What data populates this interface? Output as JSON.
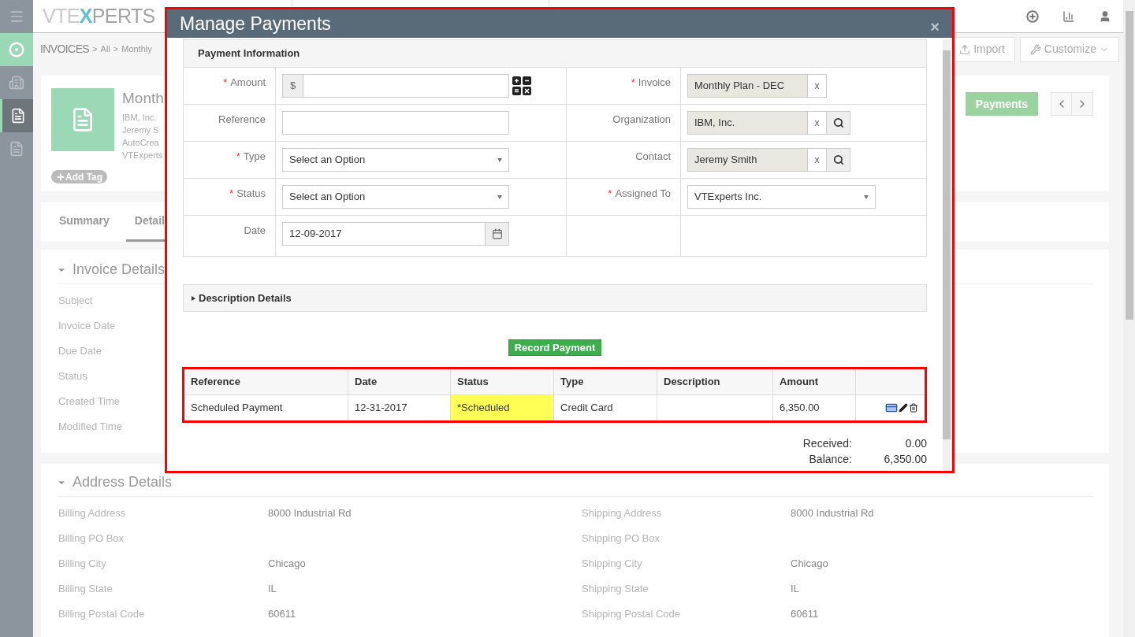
{
  "sidebar": {
    "items": [
      {
        "kind": "menu",
        "selected": false
      },
      {
        "kind": "home",
        "selected": false
      },
      {
        "kind": "organizations",
        "selected": false
      },
      {
        "kind": "invoices",
        "selected": true
      },
      {
        "kind": "sales-orders",
        "selected": false
      }
    ]
  },
  "logo": {
    "parts": [
      {
        "text": "VTE",
        "color": "#c9c9c9"
      },
      {
        "text": "X",
        "color": "#5cc3cb"
      },
      {
        "text": "PERTS",
        "color": "#a3a3a3"
      }
    ]
  },
  "breadcrumb": {
    "module": "INVOICES",
    "items": [
      {
        "separator": ">",
        "label": "All"
      },
      {
        "separator": ">",
        "label": "Monthly"
      }
    ]
  },
  "header_buttons": [
    {
      "label": "Import",
      "kind": "import"
    },
    {
      "label": "Customize",
      "kind": "customize"
    }
  ],
  "record": {
    "title": "Month",
    "lines": [
      "IBM, Inc.",
      "Jeremy S",
      "AutoCrea",
      "VTExperts"
    ],
    "add_tag": "Add Tag",
    "action": "Payments"
  },
  "tabs": [
    {
      "label": "Summary",
      "selected": false
    },
    {
      "label": "Detail",
      "selected": true
    }
  ],
  "invoice_details": {
    "title": "Invoice Details",
    "labels": [
      "Subject",
      "Invoice Date",
      "Due Date",
      "Status",
      "Created Time",
      "Modified Time"
    ]
  },
  "address_details": {
    "title": "Address Details",
    "fields": [
      {
        "label": "Billing Address",
        "value": "8000 Industrial Rd"
      },
      {
        "label": "Shipping Address",
        "value": "8000 Industrial Rd"
      },
      {
        "label": "Billing PO Box"
      },
      {
        "label": "Shipping PO Box"
      },
      {
        "label": "Billing City",
        "value": "Chicago"
      },
      {
        "label": "Shipping City",
        "value": "Chicago"
      },
      {
        "label": "Billing State",
        "value": "IL"
      },
      {
        "label": "Shipping State",
        "value": "IL"
      },
      {
        "label": "Billing Postal Code",
        "value": "60611"
      },
      {
        "label": "Shipping Postal Code",
        "value": "60611"
      }
    ]
  },
  "modal": {
    "title": "Manage Payments",
    "close": "×",
    "payment_information": {
      "title": "Payment Information",
      "fields": [
        {
          "label": "Amount",
          "required_mark": "*",
          "kind": "currency",
          "prefix": "$"
        },
        {
          "label": "Invoice",
          "required_mark": "*",
          "kind": "reference",
          "value": "Monthly Plan - DEC",
          "clear": "x",
          "search": false
        },
        {
          "label": "Reference",
          "kind": "text"
        },
        {
          "label": "Organization",
          "kind": "reference",
          "value": "IBM, Inc.",
          "clear": "x",
          "search": true
        },
        {
          "label": "Type",
          "required_mark": "*",
          "kind": "select",
          "value": "Select an Option"
        },
        {
          "label": "Contact",
          "kind": "reference",
          "value": "Jeremy Smith",
          "clear": "x",
          "search": true
        },
        {
          "label": "Status",
          "required_mark": "*",
          "kind": "select",
          "value": "Select an Option"
        },
        {
          "label": "Assigned To",
          "required_mark": "*",
          "kind": "picklist",
          "value": "VTExperts Inc."
        },
        {
          "label": "Date",
          "kind": "date",
          "value": "12-09-2017"
        }
      ]
    },
    "description": {
      "title": "Description Details",
      "expanded": false
    },
    "record_button": "Record Payment",
    "table": {
      "columns": [
        "Reference",
        "Date",
        "Status",
        "Type",
        "Description",
        "Amount"
      ],
      "rows": [
        {
          "cells": [
            {
              "text": "Scheduled Payment",
              "highlight": false
            },
            {
              "text": "12-31-2017",
              "highlight": false
            },
            {
              "text": "*Scheduled",
              "highlight": true
            },
            {
              "text": "Credit Card",
              "highlight": false
            },
            {
              "highlight": false
            },
            {
              "text": "6,350.00",
              "highlight": false
            }
          ]
        }
      ]
    },
    "totals": [
      {
        "label": "Received:",
        "value": "0.00"
      },
      {
        "label": "Balance:",
        "value": "6,350.00"
      }
    ]
  }
}
